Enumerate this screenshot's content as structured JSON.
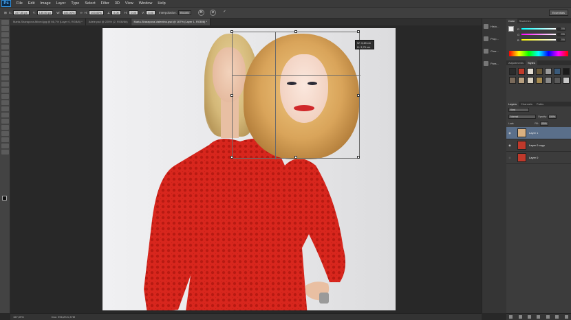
{
  "app": {
    "logo": "Ps"
  },
  "menu": [
    "File",
    "Edit",
    "Image",
    "Layer",
    "Type",
    "Select",
    "Filter",
    "3D",
    "View",
    "Window",
    "Help"
  ],
  "options": {
    "x_value": "377,00 px",
    "y_value": "130,50 px",
    "w_value": "100,00%",
    "h_value": "100,00%",
    "angle_value": "0,00",
    "h_skew": "0,00",
    "v_skew": "0,00",
    "interpolation_label": "Interpolation:",
    "interpolation_value": "Bicubic",
    "workspace": "Essentials"
  },
  "tabs": [
    {
      "label": "Maria-Sharapova-Mixed.jpg @ 66,7% (Layer 0, RGB/8) *",
      "active": false
    },
    {
      "label": "Adele.psd @ 225% (2, RGB/8#)",
      "active": false
    },
    {
      "label": "Maria-Sharapova-Valentino.psd @ 167% (Layer 1, RGB/8) *",
      "active": true
    }
  ],
  "transform_info": {
    "w": "W: 3,48 cm",
    "h": "H: 3,75 cm"
  },
  "status": {
    "zoom": "167,09%",
    "doc": "Doc: 996,2K/1,37M"
  },
  "dock": [
    "Histo...",
    "Prop...",
    "Char...",
    "Para..."
  ],
  "color_panel": {
    "tabs": [
      "Color",
      "Swatches"
    ],
    "channels": [
      {
        "ch": "R",
        "val": "255"
      },
      {
        "ch": "G",
        "val": "255"
      },
      {
        "ch": "B",
        "val": "255"
      }
    ]
  },
  "styles_panel": {
    "tabs": [
      "Adjustments",
      "Styles"
    ],
    "swatches": [
      "#2b2b2b",
      "#c23b2a",
      "#e2dcd0",
      "#6b5a3a",
      "#9b9b9b",
      "#3a5a7a",
      "#1b1b1b",
      "#7a6a5a",
      "#b8a080",
      "#d8d0c0",
      "#a58a50",
      "#8a8a8a",
      "#5a5a5a",
      "#c8c8c8"
    ]
  },
  "layers_panel": {
    "tabs": [
      "Layers",
      "Channels",
      "Paths"
    ],
    "kind": "Kind",
    "blend_mode": "Normal",
    "opacity_label": "Opacity:",
    "opacity_value": "100%",
    "lock_label": "Lock:",
    "fill_label": "Fill:",
    "fill_value": "100%",
    "layers": [
      {
        "name": "Layer 1",
        "selected": true,
        "thumb": "#d9b080"
      },
      {
        "name": "Layer 0 copy",
        "selected": false,
        "thumb": "#c0392b"
      },
      {
        "name": "Layer 0",
        "selected": false,
        "thumb": "#c0392b"
      }
    ]
  }
}
